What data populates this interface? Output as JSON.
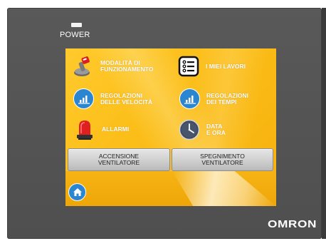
{
  "device": {
    "power_label": "POWER",
    "brand": "OMRON"
  },
  "menu": {
    "items": [
      {
        "label": "MODALITÀ DI\nFUNZIONAMENTO",
        "icon": "joystick-icon"
      },
      {
        "label": "I MIEI LAVORI",
        "icon": "list-icon"
      },
      {
        "label": "REGOLAZIONI\nDELLE VELOCITÀ",
        "icon": "bar-chart-icon"
      },
      {
        "label": "REGOLAZIONI\nDEI TEMPI",
        "icon": "bar-chart-icon"
      },
      {
        "label": "ALLARMI",
        "icon": "alarm-beacon-icon"
      },
      {
        "label": "DATA\nE ORA",
        "icon": "clock-icon"
      }
    ]
  },
  "buttons": {
    "fan_on": "ACCENSIONE\nVENTILATORE",
    "fan_off": "SPEGNIMENTO\nVENTILATORE"
  },
  "home": {
    "icon": "home-icon"
  },
  "colors": {
    "bezel": "#555555",
    "screen_bg": "#fbbd17",
    "icon_blue": "#2a86d1",
    "button_gray": "#cfcfcf",
    "text_white": "#ffffff"
  }
}
